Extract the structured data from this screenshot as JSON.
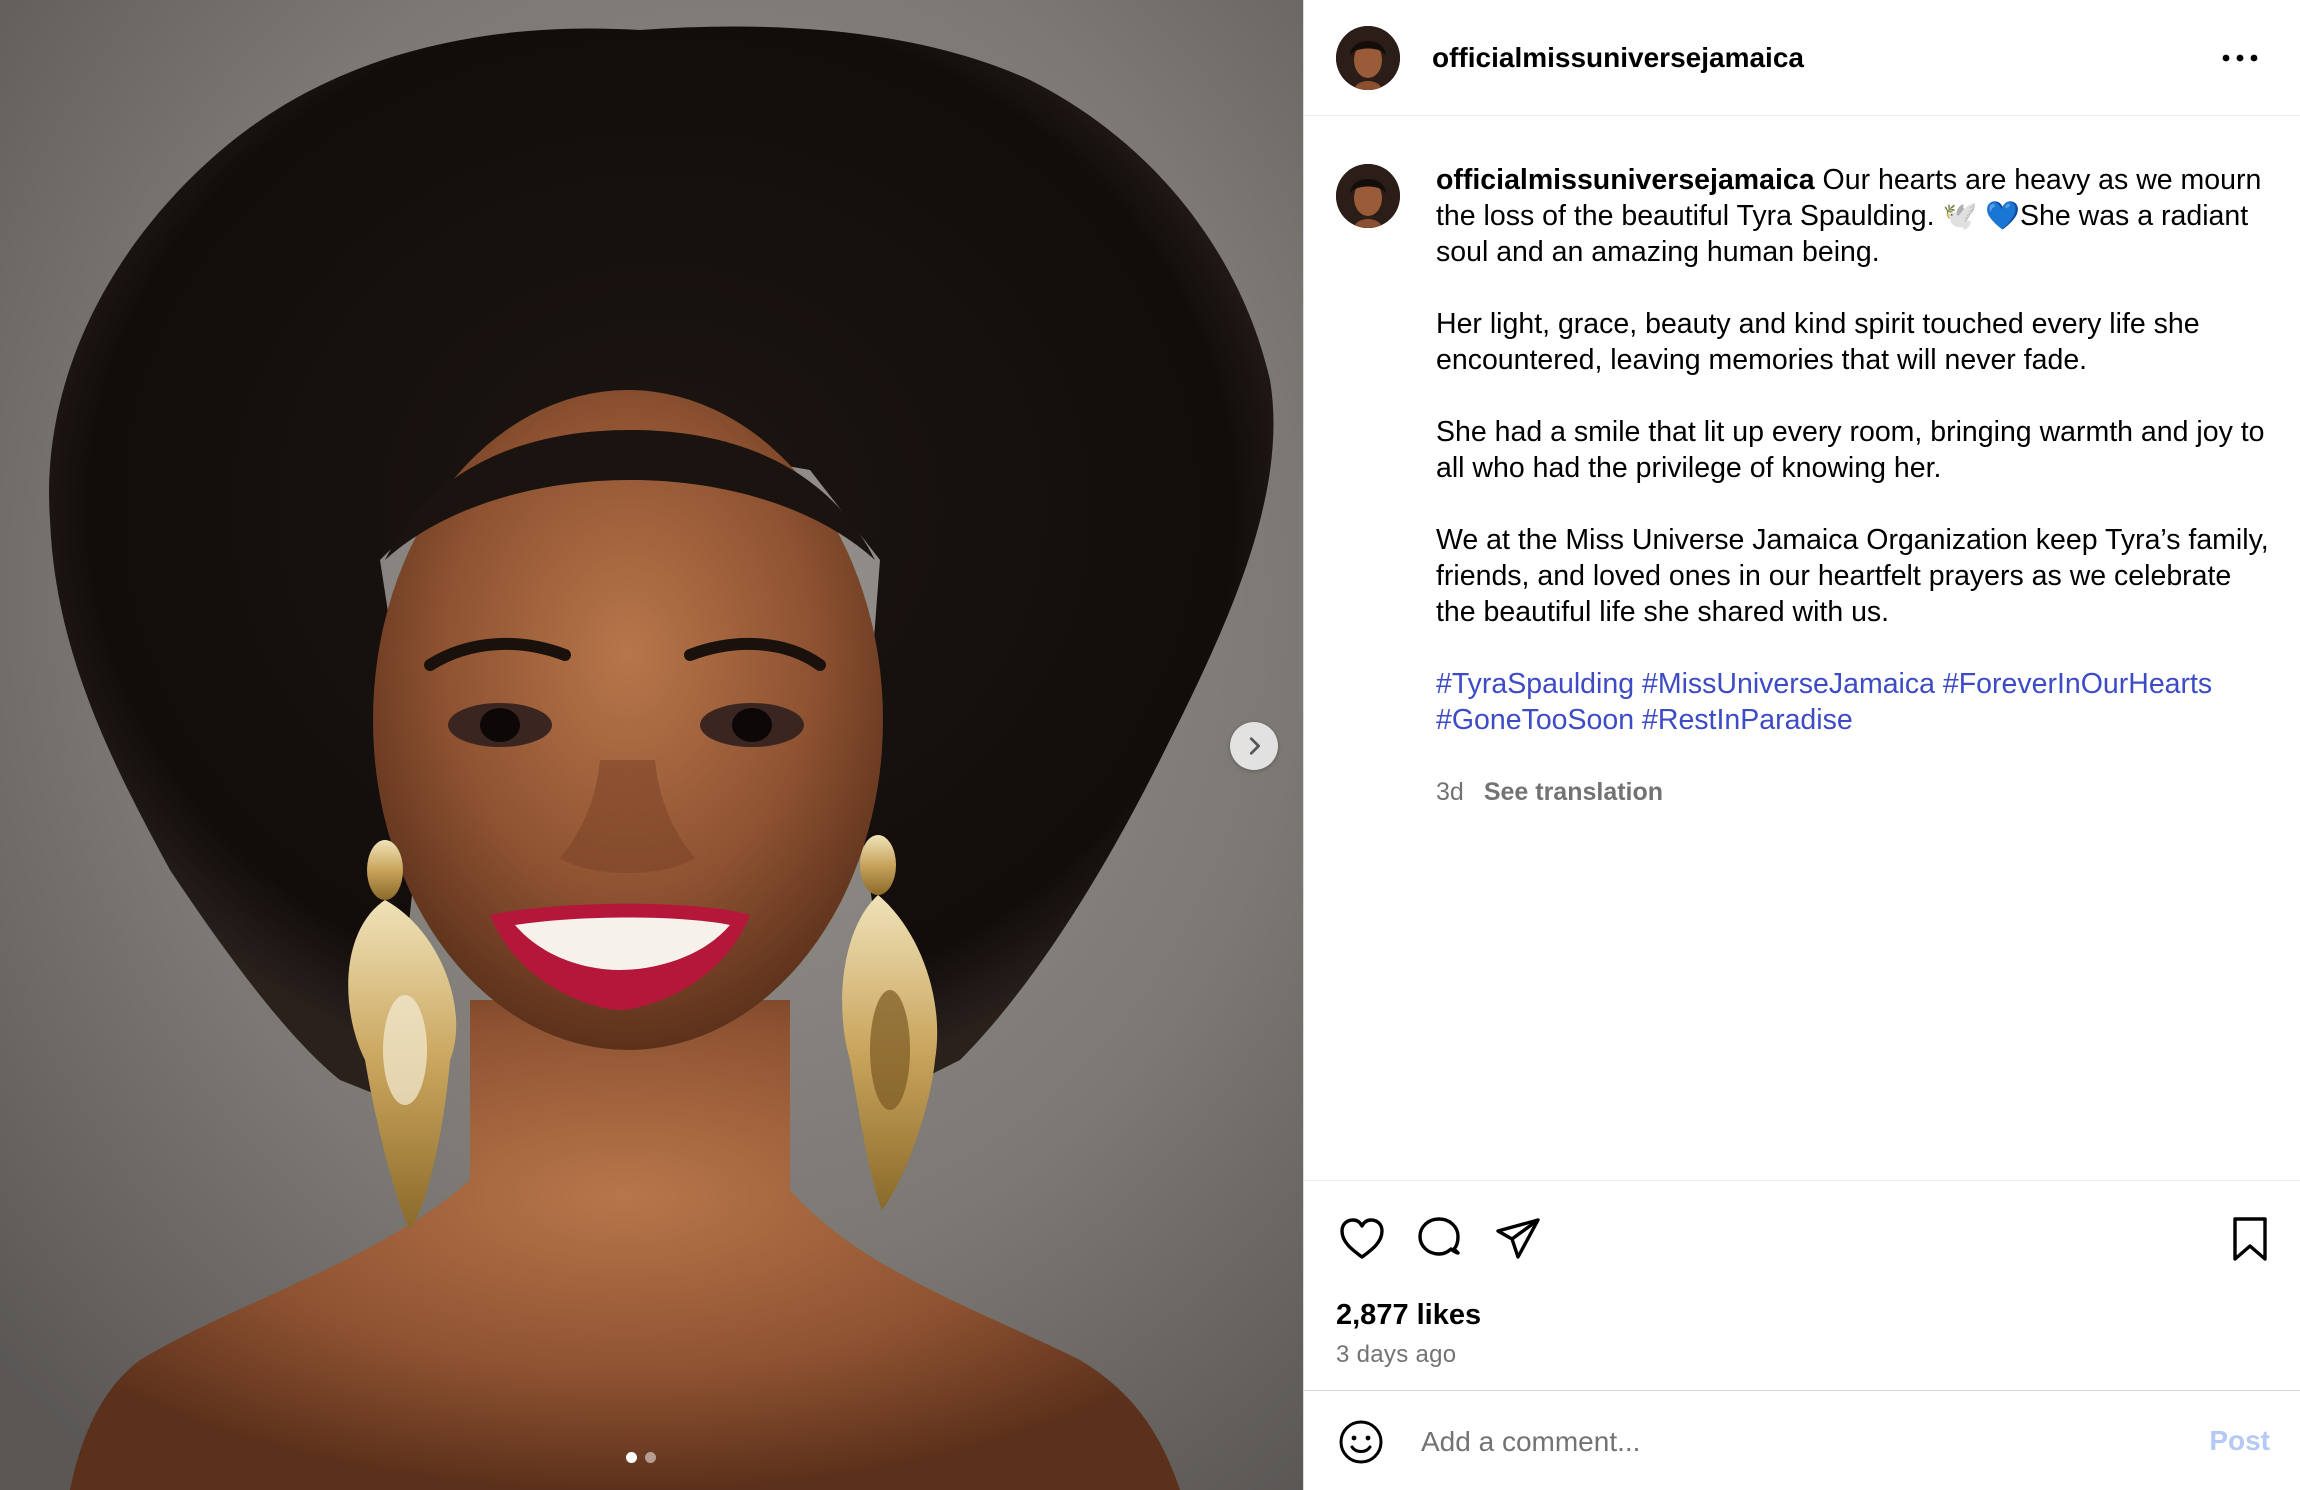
{
  "media": {
    "image_alt": "Portrait of a smiling woman with natural curly hair and large gold earrings",
    "carousel_total": 2,
    "carousel_active": 1,
    "next_icon": "chevron-right-icon"
  },
  "header": {
    "username": "officialmissuniversejamaica",
    "more_icon": "more-horizontal-icon"
  },
  "caption": {
    "username": "officialmissuniversejamaica",
    "line1_text": "Our hearts are heavy as we mourn the loss of the beautiful Tyra Spaulding.",
    "emojis": "🕊️ 💙",
    "line1_tail": "She was a radiant soul and an amazing human being.",
    "paragraph2": "Her light, grace, beauty and kind spirit touched every life she encountered, leaving memories that will never fade.",
    "paragraph3": "She had a smile that lit up every room, bringing warmth and joy to all who had the privilege of knowing her.",
    "paragraph4": "We at the Miss Universe Jamaica Organization keep Tyra’s family, friends, and loved ones in our heartfelt prayers as we celebrate the beautiful life she shared with us.",
    "hashtags": [
      "#TyraSpaulding",
      "#MissUniverseJamaica",
      "#ForeverInOurHearts",
      "#GoneTooSoon",
      "#RestInParadise"
    ],
    "age": "3d",
    "see_translation": "See translation"
  },
  "actions": {
    "icons": [
      "heart-icon",
      "comment-icon",
      "share-icon",
      "bookmark-icon"
    ],
    "likes": "2,877 likes",
    "posted": "3 days ago"
  },
  "comment": {
    "placeholder": "Add a comment...",
    "post_label": "Post",
    "emoji_icon": "emoji-icon"
  },
  "colors": {
    "hashtag": "#3d4bc6",
    "muted": "#737373",
    "post_disabled": "#b5c9f5",
    "border": "#dbdbdb"
  }
}
